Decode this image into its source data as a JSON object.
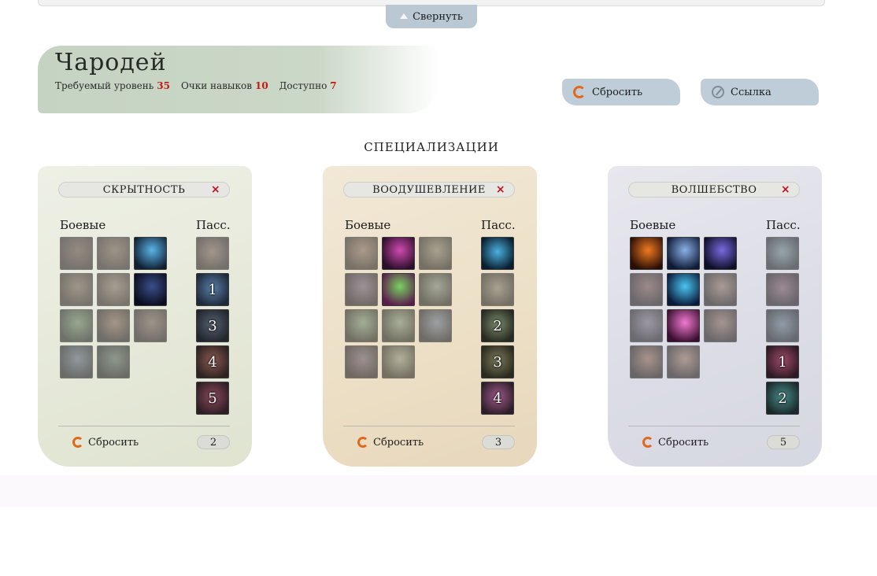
{
  "header": {
    "collapse_label": "Свернуть",
    "title": "Чародей",
    "stats": [
      {
        "label": "Требуемый уровень",
        "value": "35"
      },
      {
        "label": "Очки навыков",
        "value": "10"
      },
      {
        "label": "Доступно",
        "value": "7"
      }
    ],
    "reset_label": "Сбросить",
    "link_label": "Ссылка"
  },
  "section_title": "СПЕЦИАЛИЗАЦИИ",
  "labels": {
    "combat": "Боевые",
    "passive": "Пасс.",
    "reset": "Сбросить"
  },
  "colors": {
    "accent_red": "#c21a12",
    "reset_orange": "#df6a1e",
    "button_blue": "#bfcdd8"
  },
  "cards": [
    {
      "name": "СКРЫТНОСТЬ",
      "points": "2",
      "combat": [
        {
          "icon": "blade-strike-icon",
          "active": false,
          "c1": "#7a4a36",
          "c2": "#3a2620"
        },
        {
          "icon": "dagger-slash-icon",
          "active": false,
          "c1": "#8a5a3a",
          "c2": "#3d2a20"
        },
        {
          "icon": "shadow-figure-icon",
          "active": true,
          "c1": "#5ab4e6",
          "c2": "#102033"
        },
        {
          "icon": "evasion-icon",
          "active": false,
          "c1": "#8a5c3c",
          "c2": "#3a2a1e"
        },
        {
          "icon": "arrow-shot-icon",
          "active": false,
          "c1": "#9a6a4c",
          "c2": "#402a22"
        },
        {
          "icon": "stealth-profile-icon",
          "active": true,
          "c1": "#3a4e88",
          "c2": "#0a0d1e"
        },
        {
          "icon": "poison-blade-icon",
          "active": false,
          "c1": "#4e8a3a",
          "c2": "#1e2e1e"
        },
        {
          "icon": "fire-strike-icon",
          "active": false,
          "c1": "#a25a36",
          "c2": "#2e201e"
        },
        {
          "icon": "double-blades-icon",
          "active": false,
          "c1": "#8a5a46",
          "c2": "#322220"
        },
        {
          "icon": "sprint-icon",
          "active": false,
          "c1": "#4e6a98",
          "c2": "#1a2030"
        },
        {
          "icon": "decoy-icon",
          "active": false,
          "c1": "#4a6a56",
          "c2": "#1a221e"
        }
      ],
      "passive": [
        {
          "icon": "twin-daggers-icon",
          "rank": "",
          "c1": "#9a5a4a",
          "c2": "#3a2222"
        },
        {
          "icon": "ice-shard-icon",
          "rank": "1",
          "c1": "#5a7ea8",
          "c2": "#1e2a3a"
        },
        {
          "icon": "dark-cloak-icon",
          "rank": "3",
          "c1": "#566070",
          "c2": "#22262e"
        },
        {
          "icon": "ring-guard-icon",
          "rank": "4",
          "c1": "#8a5a50",
          "c2": "#2e2222"
        },
        {
          "icon": "spirit-icon",
          "rank": "5",
          "c1": "#8a4a5a",
          "c2": "#2e1e26"
        }
      ]
    },
    {
      "name": "ВООДУШЕВЛЕНИЕ",
      "points": "3",
      "combat": [
        {
          "icon": "inspire-shield-icon",
          "active": false,
          "c1": "#9a6a46",
          "c2": "#3a2a1e"
        },
        {
          "icon": "music-notes-pink-icon",
          "active": true,
          "c1": "#d04ab0",
          "c2": "#2a0e2a"
        },
        {
          "icon": "music-notes-icon",
          "active": false,
          "c1": "#8a7a4a",
          "c2": "#2e2a1e"
        },
        {
          "icon": "meditate-icon",
          "active": false,
          "c1": "#7a5a9a",
          "c2": "#261e30"
        },
        {
          "icon": "song-blast-icon",
          "active": true,
          "c1": "#7ad060",
          "c2": "#5a1e4e"
        },
        {
          "icon": "harmony-icon",
          "active": false,
          "c1": "#6a8a6a",
          "c2": "#222a22"
        },
        {
          "icon": "green-aura-icon",
          "active": false,
          "c1": "#5a9a5a",
          "c2": "#1e2e1e"
        },
        {
          "icon": "heal-circle-icon",
          "active": false,
          "c1": "#6a9a5a",
          "c2": "#202e1e"
        },
        {
          "icon": "sky-blast-icon",
          "active": false,
          "c1": "#5a7ab0",
          "c2": "#1e2636"
        },
        {
          "icon": "lyre-icon",
          "active": false,
          "c1": "#7a5a8a",
          "c2": "#2a1e2e"
        },
        {
          "icon": "horn-icon",
          "active": false,
          "c1": "#8a9a5a",
          "c2": "#2a2e1e"
        }
      ],
      "passive": [
        {
          "icon": "glowing-hand-icon",
          "rank": "",
          "c1": "#4ab0e0",
          "c2": "#0a1e2e"
        },
        {
          "icon": "hourglass-icon",
          "rank": "",
          "c1": "#8a7a5a",
          "c2": "#2e2a22"
        },
        {
          "icon": "bell-icon",
          "rank": "2",
          "c1": "#7a8a6a",
          "c2": "#262a22"
        },
        {
          "icon": "ripple-icon",
          "rank": "3",
          "c1": "#7a7a5a",
          "c2": "#2a2a1e"
        },
        {
          "icon": "pink-aura-icon",
          "rank": "4",
          "c1": "#a05a8a",
          "c2": "#2e1e2a"
        }
      ]
    },
    {
      "name": "ВОЛШЕБСТВО",
      "points": "5",
      "combat": [
        {
          "icon": "fireball-icon",
          "active": true,
          "c1": "#f07a20",
          "c2": "#2a0e06"
        },
        {
          "icon": "lightning-spear-icon",
          "active": true,
          "c1": "#8ab0e6",
          "c2": "#0e1a36"
        },
        {
          "icon": "arcane-bolt-icon",
          "active": true,
          "c1": "#7a6ae0",
          "c2": "#0e0e26"
        },
        {
          "icon": "flame-wave-icon",
          "active": false,
          "c1": "#a04a3a",
          "c2": "#2e1a1a"
        },
        {
          "icon": "frost-step-icon",
          "active": true,
          "c1": "#4ac6f0",
          "c2": "#0a1a3a"
        },
        {
          "icon": "fire-burst-icon",
          "active": false,
          "c1": "#b06a3a",
          "c2": "#2e1e1a"
        },
        {
          "icon": "stone-icon",
          "active": false,
          "c1": "#7a6a8a",
          "c2": "#2a222e"
        },
        {
          "icon": "magic-crystal-icon",
          "active": true,
          "c1": "#f07ad0",
          "c2": "#3a0e30"
        },
        {
          "icon": "chain-lightning-icon",
          "active": false,
          "c1": "#b0603a",
          "c2": "#2e1e1a"
        },
        {
          "icon": "inferno-icon",
          "active": false,
          "c1": "#c05a2a",
          "c2": "#2e1a14"
        },
        {
          "icon": "comet-icon",
          "active": false,
          "c1": "#c06a3a",
          "c2": "#2e1e16"
        }
      ],
      "passive": [
        {
          "icon": "ward-icon",
          "rank": "",
          "c1": "#4a8a9a",
          "c2": "#1a2a30"
        },
        {
          "icon": "tentacle-icon",
          "rank": "",
          "c1": "#a04a6a",
          "c2": "#2e1a22"
        },
        {
          "icon": "mist-icon",
          "rank": "",
          "c1": "#4a7a9a",
          "c2": "#1a2430"
        },
        {
          "icon": "rune-icon",
          "rank": "1",
          "c1": "#a04a6a",
          "c2": "#2e1a24"
        },
        {
          "icon": "spirit-wave-icon",
          "rank": "2",
          "c1": "#4a8a8a",
          "c2": "#1a2a2a"
        }
      ]
    }
  ]
}
